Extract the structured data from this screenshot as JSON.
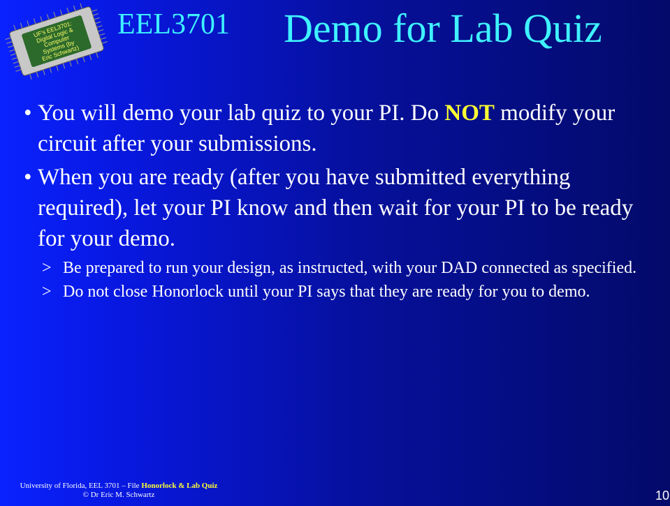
{
  "header": {
    "logo_lines": [
      "UF's EEL3701:",
      "Digital Logic &",
      "Computer",
      "Systems (by",
      "Eric Schwartz)"
    ],
    "course_code": "EEL3701",
    "title": "Demo for Lab Quiz"
  },
  "bullets": [
    {
      "pre": "You will demo your lab quiz to your PI. Do ",
      "emphasis": "NOT",
      "post": " modify your circuit after your submissions."
    },
    {
      "text": "When you are ready (after you have submitted everything required), let your PI know and then wait for your PI to be ready for your demo.",
      "subitems": [
        "Be prepared to run your design, as instructed, with your DAD connected as specified.",
        "Do not close Honorlock until your PI says that they are ready for you to demo."
      ]
    }
  ],
  "footer": {
    "line1_prefix": "University of Florida, EEL 3701 – File ",
    "line1_highlight": "Honorlock & Lab Quiz",
    "line2": "© Dr Eric M. Schwartz"
  },
  "page_number": "10",
  "colors": {
    "title": "#3ff2ff",
    "emphasis": "#ffff33",
    "background_left": "#0a22ff",
    "background_right": "#030a6a"
  }
}
